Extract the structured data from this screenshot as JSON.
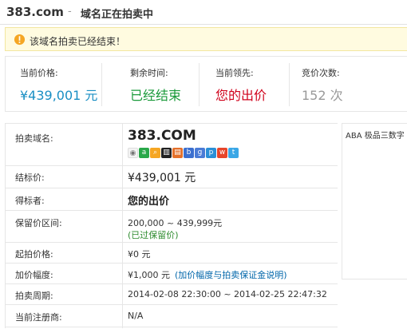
{
  "header": {
    "domain": "383.com",
    "separator": "-",
    "status": "域名正在拍卖中"
  },
  "alert": {
    "icon": "warning-icon",
    "text": "该域名拍卖已经结束！"
  },
  "stats": {
    "current_price_label": "当前价格:",
    "current_price_value": "¥439,001 元",
    "time_left_label": "剩余时间:",
    "time_left_value": "已经结束",
    "leader_label": "当前领先:",
    "leader_value": "您的出价",
    "bid_count_label": "竞价次数:",
    "bid_count_value": "152 次"
  },
  "details": {
    "domain_label": "拍卖域名:",
    "domain_value": "383.COM",
    "final_price_label": "结标价:",
    "final_price_value": "¥439,001 元",
    "winner_label": "得标者:",
    "winner_value": "您的出价",
    "reserve_label": "保留价区间:",
    "reserve_value": "200,000 ~ 439,999元",
    "reserve_note": "(已过保留价)",
    "start_price_label": "起拍价格:",
    "start_price_value": "¥0 元",
    "increment_label": "加价幅度:",
    "increment_value": "¥1,000 元",
    "increment_link": "(加价幅度与拍卖保证金说明)",
    "period_label": "拍卖周期:",
    "period_value": "2014-02-08 22:30:00 ~ 2014-02-25 22:47:32",
    "registrar_label": "当前注册商:",
    "registrar_value": "N/A"
  },
  "share_icons": [
    "eye-icon",
    "a-icon",
    "search-icon",
    "bank-icon",
    "chart-icon",
    "baidu-icon",
    "g-icon",
    "p-icon",
    "weibo-icon",
    "twitter-icon"
  ],
  "side": {
    "text": "ABA 极品三数字"
  },
  "colors": {
    "price": "#1a8fc4",
    "status_ended": "#1a9a3a",
    "leader": "#d0021b",
    "bid_count": "#999999"
  }
}
